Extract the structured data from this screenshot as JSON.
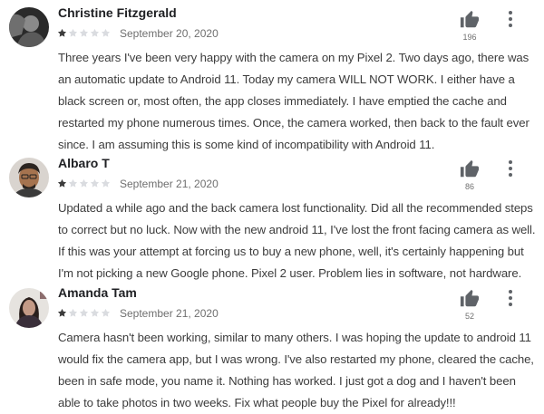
{
  "reviews": [
    {
      "name": "Christine Fitzgerald",
      "rating": 1,
      "rating_max": 5,
      "date": "September 20, 2020",
      "likes": "196",
      "text": "Three years I've been very happy with the camera on my Pixel 2. Two days ago, there was an automatic update to Android 11. Today my camera WILL NOT WORK. I either have a black screen or, most often, the app closes immediately. I have emptied the cache and restarted my phone numerous times. Once, the camera worked, then back to the fault ever since. I am assuming this is some kind of incompatibility with Android 11."
    },
    {
      "name": "Albaro T",
      "rating": 1,
      "rating_max": 5,
      "date": "September 21, 2020",
      "likes": "86",
      "text": "Updated a while ago and the back camera lost functionality. Did all the recommended steps to correct but no luck. Now with the new android 11, I've lost the front facing camera as well. If this was your attempt at forcing us to buy a new phone, well, it's certainly happening but I'm not picking a new Google phone. Pixel 2 user. Problem lies in software, not hardware."
    },
    {
      "name": "Amanda Tam",
      "rating": 1,
      "rating_max": 5,
      "date": "September 21, 2020",
      "likes": "52",
      "text": "Camera hasn't been working, similar to many others. I was hoping the update to android 11 would fix the camera app, but I was wrong. I've also restarted my phone, cleared the cache, been in safe mode, you name it. Nothing has worked. I just got a dog and I haven't been able to take photos in two weeks. Fix what people buy the Pixel for already!!!"
    }
  ],
  "colors": {
    "star_filled": "#3c3c3c",
    "star_empty": "#dadce0",
    "icon": "#5f6368",
    "text": "#3c3c3c",
    "muted": "#6f6f6f"
  },
  "icons": {
    "like": "thumb-up-icon",
    "more": "more-vert-icon",
    "star": "star-icon"
  }
}
